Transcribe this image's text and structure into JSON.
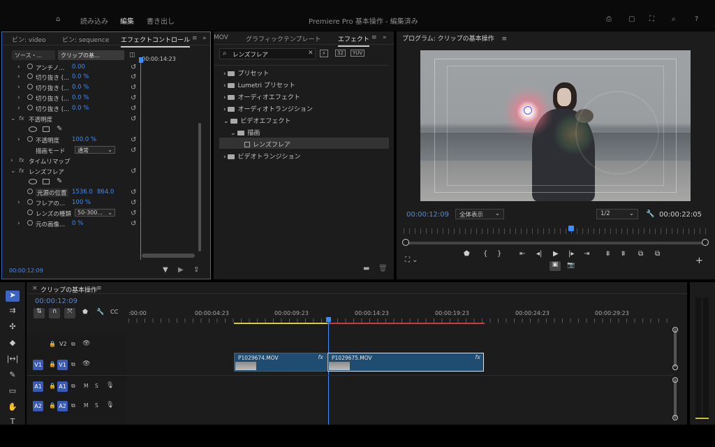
{
  "app": {
    "title": "Premiere Pro 基本操作 - 編集済み",
    "menu": [
      "読み込み",
      "編集",
      "書き出し"
    ]
  },
  "effect_controls": {
    "tabs": [
      "ビン: video",
      "ビン: sequence",
      "エフェクトコントロール"
    ],
    "source_label": "ソース・...",
    "clip_label": "クリップの基...",
    "timecode_head": "00:00:14:23",
    "rows": [
      {
        "label": "アンチノ...",
        "value": "0.00"
      },
      {
        "label": "切り抜き (...",
        "value": "0.0 %"
      },
      {
        "label": "切り抜き (...",
        "value": "0.0 %"
      },
      {
        "label": "切り抜き (...",
        "value": "0.0 %"
      },
      {
        "label": "切り抜き (...",
        "value": "0.0 %"
      }
    ],
    "opacity_section": "不透明度",
    "opacity_label": "不透明度",
    "opacity_value": "100.0 %",
    "blend_label": "描画モード",
    "blend_value": "通常",
    "timeremap": "タイムリマップ",
    "lensflare": "レンズフレア",
    "center_label": "光源の位置",
    "center_x": "1536.0",
    "center_y": "864.0",
    "brightness_label": "フレアの...",
    "brightness_value": "100 %",
    "lens_label": "レンズの種類",
    "lens_value": "50-300...",
    "blend_orig_label": "元の画像...",
    "blend_orig_value": "0 %",
    "timecode": "00:00:12:09"
  },
  "effects": {
    "tabs": [
      "MOV",
      "グラフィックテンプレート",
      "エフェクト"
    ],
    "search": "レンズフレア",
    "tree": [
      "プリセット",
      "Lumetri プリセット",
      "オーディオエフェクト",
      "オーディオトランジション",
      "ビデオエフェクト",
      "描画",
      "レンズフレア",
      "ビデオトランジション"
    ]
  },
  "program": {
    "title": "プログラム: クリップの基本操作",
    "timecode": "00:00:12:09",
    "zoom": "全体表示",
    "quality": "1/2",
    "duration": "00:00:22:05"
  },
  "timeline": {
    "title": "クリップの基本操作",
    "timecode": "00:00:12:09",
    "ruler": [
      ":00:00",
      "00:00:04:23",
      "00:00:09:23",
      "00:00:14:23",
      "00:00:19:23",
      "00:00:24:23",
      "00:00:29:23"
    ],
    "tracks": [
      "V2",
      "V1",
      "A1",
      "A2"
    ],
    "clips": [
      "P1029674.MOV",
      "P1029675.MOV"
    ],
    "fx": "fx"
  },
  "colors": {
    "accent": "#3e8dff",
    "clip": "#1f4d72",
    "playhead": "#3e8dff"
  }
}
